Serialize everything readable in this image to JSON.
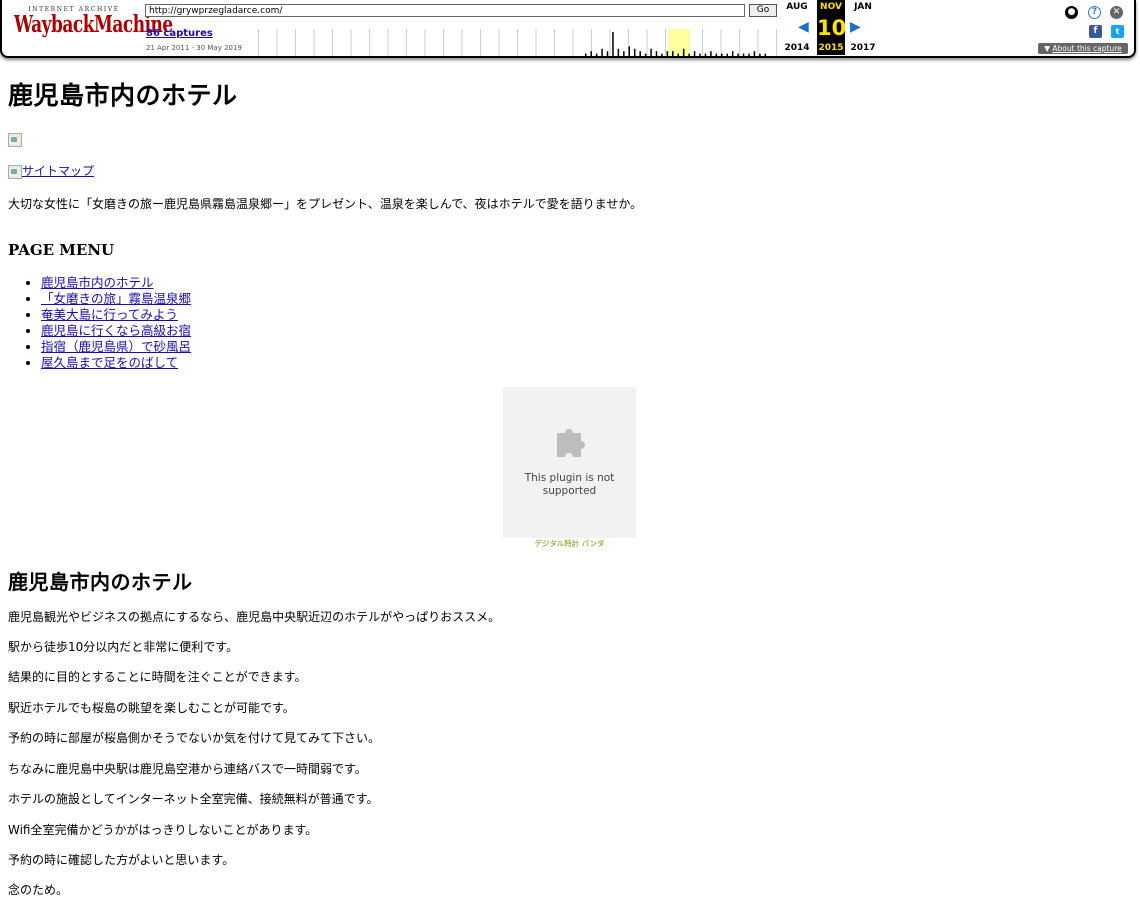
{
  "toolbar": {
    "ia_text": "INTERNET ARCHIVE",
    "wayback_text": "WaybackMachine",
    "url": "http://grywprzegladarce.com/",
    "go_label": "Go",
    "captures": "86 captures",
    "date_range": "21 Apr 2011 - 30 May 2019",
    "prev_month": "AUG",
    "cur_month": "NOV",
    "next_month": "JAN",
    "cur_day": "10",
    "prev_year": "2014",
    "cur_year": "2015",
    "next_year": "2017",
    "about": "About this capture",
    "capture_levels": [
      0.1,
      0.2,
      0.1,
      0.3,
      0.2,
      1.0,
      0.3,
      0.2,
      0.4,
      0.3,
      0.2,
      0.1,
      0.3,
      0.2,
      0.1,
      0.2,
      0.2,
      0.1,
      0.3,
      0.1,
      0.2,
      0.1,
      0.1,
      0.2,
      0.1,
      0.1,
      0.1,
      0.2,
      0.1,
      0.1,
      0.1,
      0.2,
      0.1,
      0.1
    ]
  },
  "page": {
    "title": "鹿児島市内のホテル",
    "sitemap_link": "サイトマップ",
    "intro": "大切な女性に「女磨きの旅ー鹿児島県霧島温泉郷ー」をプレゼント、温泉を楽しんで、夜はホテルで愛を語りませか。",
    "menu_heading": "PAGE MENU",
    "menu": [
      "鹿児島市内のホテル",
      "「女磨きの旅」霧島温泉郷",
      "奄美大島に行ってみよう",
      "鹿児島に行くなら高級お宿",
      "指宿（鹿児島県）で砂風呂",
      "屋久島まで足をのばして"
    ],
    "plugin_text": "This plugin is not supported",
    "plugin_caption": "デジタル時計 パンダ",
    "section_title": "鹿児島市内のホテル",
    "paragraphs": [
      "鹿児島観光やビジネスの拠点にするなら、鹿児島中央駅近辺のホテルがやっぱりおススメ。",
      "駅から徒歩10分以内だと非常に便利です。",
      "結果的に目的とすることに時間を注ぐことができます。",
      "駅近ホテルでも桜島の眺望を楽しむことが可能です。",
      "予約の時に部屋が桜島側かそうでないか気を付けて見てみて下さい。",
      "ちなみに鹿児島中央駅は鹿児島空港から連絡バスで一時間弱です。",
      "ホテルの施設としてインターネット全室完備、接続無料が普通です。",
      "Wifi全室完備かどうかがはっきりしないことがあります。",
      "予約の時に確認した方がよいと思います。",
      "念のため。"
    ]
  }
}
